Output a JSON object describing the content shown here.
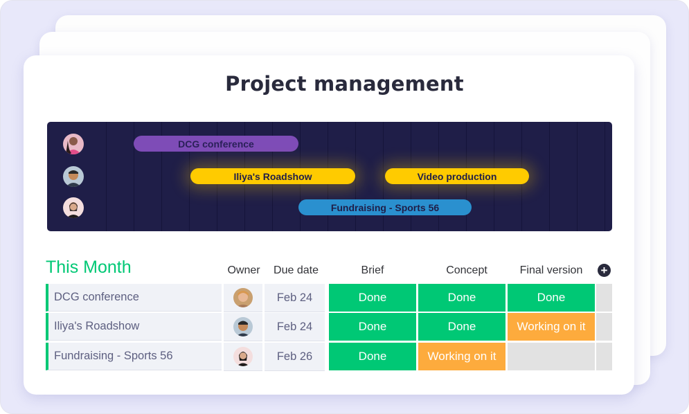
{
  "board": {
    "title": "Project management"
  },
  "timeline": {
    "people": [
      {
        "name": "owner-1",
        "avatar_bg": "#e9b9c7",
        "avatar_fg": "#3a2a30"
      },
      {
        "name": "owner-2",
        "avatar_bg": "#b9c9d6",
        "avatar_fg": "#3a3028"
      },
      {
        "name": "owner-3",
        "avatar_bg": "#f4dede",
        "avatar_fg": "#2a2020"
      }
    ],
    "bars": [
      {
        "label": "DCG conference",
        "color": "purple",
        "row": 0
      },
      {
        "label": "Iliya's Roadshow",
        "color": "yellow",
        "row": 1
      },
      {
        "label": "Video production",
        "color": "yellow",
        "row": 1
      },
      {
        "label": "Fundraising - Sports 56",
        "color": "blue",
        "row": 2
      }
    ]
  },
  "group": {
    "title": "This Month",
    "color": "#00c875",
    "columns": [
      "Owner",
      "Due date",
      "Brief",
      "Concept",
      "Final version"
    ],
    "add_column_icon": "plus-circle-icon",
    "rows": [
      {
        "name": "DCG conference",
        "due": "Feb 24",
        "brief": "Done",
        "concept": "Done",
        "final": "Done"
      },
      {
        "name": "Iliya's Roadshow",
        "due": "Feb 24",
        "brief": "Done",
        "concept": "Done",
        "final": "Working on it"
      },
      {
        "name": "Fundraising - Sports 56",
        "due": "Feb 26",
        "brief": "Done",
        "concept": "Working on it",
        "final": ""
      }
    ]
  },
  "colors": {
    "done": "#00c875",
    "working": "#fdab3d",
    "empty": "#e2e2e2",
    "timeline_bg": "#1f1e48"
  }
}
